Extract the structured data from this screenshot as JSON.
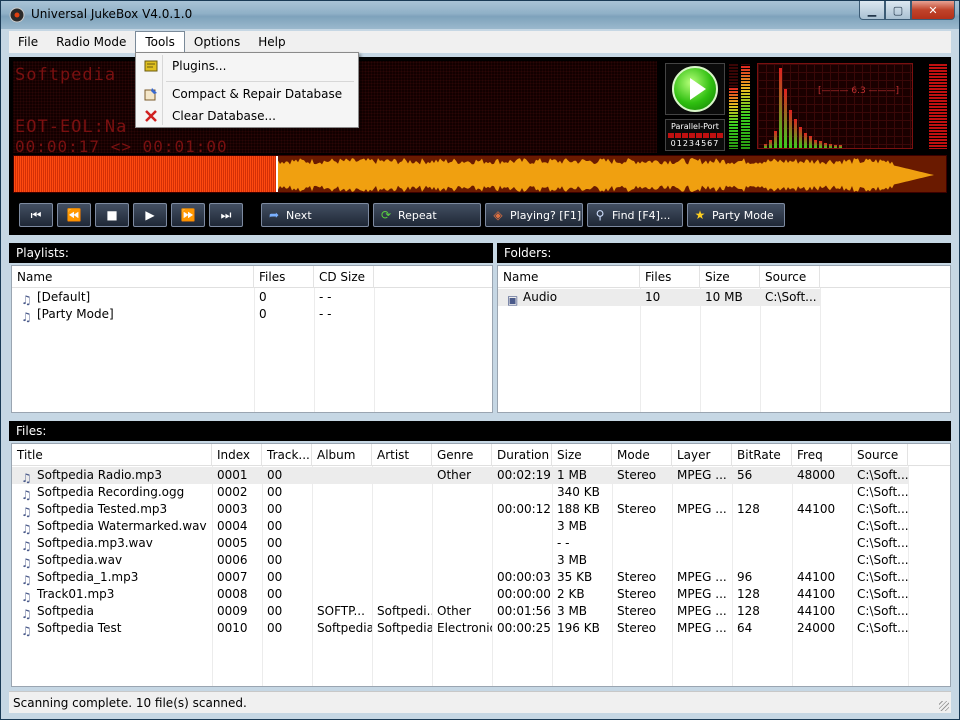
{
  "window": {
    "title": "Universal JukeBox V4.0.1.0",
    "min_glyph": "▁",
    "max_glyph": "▢",
    "close_glyph": "✕"
  },
  "menu": [
    "File",
    "Radio Mode",
    "Tools",
    "Options",
    "Help"
  ],
  "active_menu": "Tools",
  "tools_menu": [
    {
      "label": "Plugins...",
      "icon": "plugins-icon"
    },
    {
      "label": "Compact & Repair Database",
      "icon": "compact-database-icon"
    },
    {
      "label": "Clear Database...",
      "icon": "clear-database-icon"
    }
  ],
  "player": {
    "lcd_title": "Softpedia",
    "lcd_line2": "EOT-EOL:Na",
    "lcd_line3": "00:00:17 <> 00:01:00",
    "parallel_port_label": "Parallel-Port",
    "parallel_port_bits": "01234567",
    "spectrum_readout": "[——— 6.3 ———]",
    "progress": 0.28,
    "vu_levels": [
      0.72,
      0.98
    ],
    "spectrum_levels": [
      0.05,
      0.1,
      0.2,
      0.95,
      0.7,
      0.45,
      0.35,
      0.25,
      0.18,
      0.14,
      0.1,
      0.08,
      0.06,
      0.05,
      0.04,
      0.03
    ],
    "buttons": {
      "next": "Next",
      "repeat": "Repeat",
      "playing": "Playing? [F1]",
      "find": "Find [F4]...",
      "party": "Party Mode"
    },
    "transport_glyphs": {
      "first": "⏮",
      "rewind": "⏪",
      "stop": "■",
      "play": "▶",
      "forward": "⏩",
      "last": "⏭"
    },
    "button_glyphs": {
      "next": "➦",
      "repeat": "⟳",
      "playing": "◈",
      "find": "⚲",
      "party": "★"
    }
  },
  "playlists": {
    "header": "Playlists:",
    "columns": [
      "Name",
      "Files",
      "CD Size"
    ],
    "rows": [
      {
        "name": "[Default]",
        "files": "0",
        "cd_size": "- -"
      },
      {
        "name": "[Party Mode]",
        "files": "0",
        "cd_size": "- -"
      }
    ]
  },
  "folders": {
    "header": "Folders:",
    "columns": [
      "Name",
      "Files",
      "Size",
      "Source"
    ],
    "rows": [
      {
        "name": "Audio",
        "files": "10",
        "size": "10 MB",
        "source": "C:\\Soft..."
      }
    ]
  },
  "files": {
    "header": "Files:",
    "columns": [
      "Title",
      "Index",
      "Track...",
      "Album",
      "Artist",
      "Genre",
      "Duration",
      "Size",
      "Mode",
      "Layer",
      "BitRate",
      "Freq",
      "Source"
    ],
    "rows": [
      [
        "Softpedia Radio.mp3",
        "0001",
        "00",
        "",
        "",
        "Other",
        "00:02:19",
        "1 MB",
        "Stereo",
        "MPEG ...",
        "56",
        "48000",
        "C:\\Soft..."
      ],
      [
        "Softpedia Recording.ogg",
        "0002",
        "00",
        "",
        "",
        "",
        "",
        "340 KB",
        "",
        "",
        "",
        "",
        "C:\\Soft..."
      ],
      [
        "Softpedia Tested.mp3",
        "0003",
        "00",
        "",
        "",
        "",
        "00:00:12",
        "188 KB",
        "Stereo",
        "MPEG ...",
        "128",
        "44100",
        "C:\\Soft..."
      ],
      [
        "Softpedia Watermarked.wav",
        "0004",
        "00",
        "",
        "",
        "",
        "",
        "3 MB",
        "",
        "",
        "",
        "",
        "C:\\Soft..."
      ],
      [
        "Softpedia.mp3.wav",
        "0005",
        "00",
        "",
        "",
        "",
        "",
        "- -",
        "",
        "",
        "",
        "",
        "C:\\Soft..."
      ],
      [
        "Softpedia.wav",
        "0006",
        "00",
        "",
        "",
        "",
        "",
        "3 MB",
        "",
        "",
        "",
        "",
        "C:\\Soft..."
      ],
      [
        "Softpedia_1.mp3",
        "0007",
        "00",
        "",
        "",
        "",
        "00:00:03",
        "35 KB",
        "Stereo",
        "MPEG ...",
        "96",
        "44100",
        "C:\\Soft..."
      ],
      [
        "Track01.mp3",
        "0008",
        "00",
        "",
        "",
        "",
        "00:00:00",
        "2 KB",
        "Stereo",
        "MPEG ...",
        "128",
        "44100",
        "C:\\Soft..."
      ],
      [
        "Softpedia",
        "0009",
        "00",
        "SOFTP...",
        "Softpedi...",
        "Other",
        "00:01:56",
        "3 MB",
        "Stereo",
        "MPEG ...",
        "128",
        "44100",
        "C:\\Soft..."
      ],
      [
        "Softpedia Test",
        "0010",
        "00",
        "Softpedia",
        "Softpedia",
        "Electronic",
        "00:00:25",
        "196 KB",
        "Stereo",
        "MPEG ...",
        "64",
        "24000",
        "C:\\Soft..."
      ]
    ]
  },
  "status": "Scanning complete. 10 file(s) scanned.",
  "colors": {
    "accent": "#ff4a10",
    "lcd_text": "#7a1010",
    "play_green": "#2fbf10"
  }
}
